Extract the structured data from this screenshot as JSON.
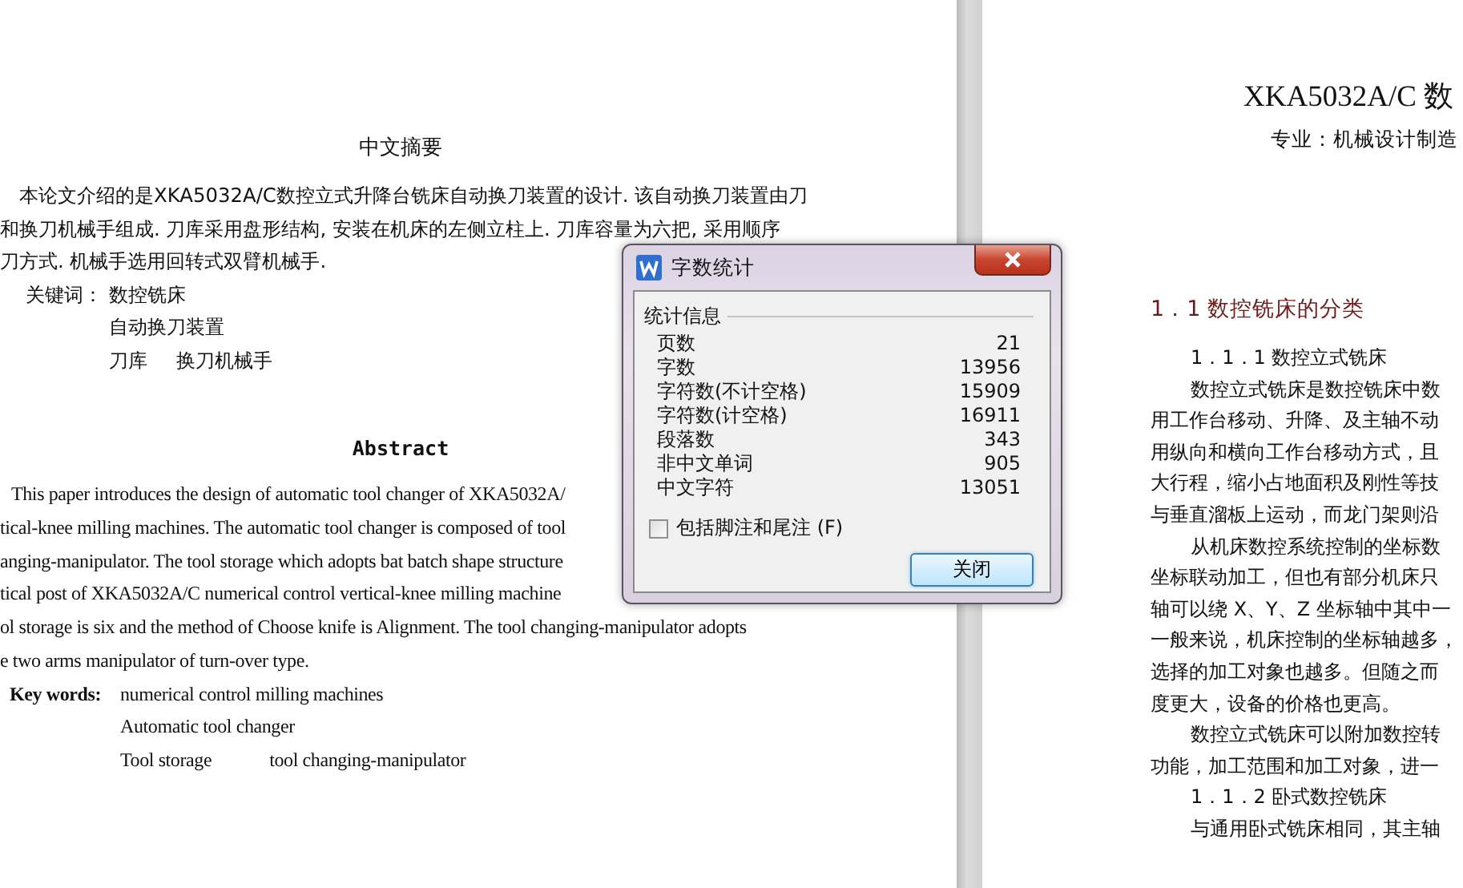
{
  "left_page": {
    "chinese_abstract": {
      "heading": "中文摘要",
      "paragraph_lines": [
        "本论文介绍的是XKA5032A/C数控立式升降台铣床自动换刀装置的设计. 该自动换刀装置由刀",
        "和换刀机械手组成. 刀库采用盘形结构, 安装在机床的左侧立柱上. 刀库容量为六把, 采用顺序",
        "刀方式. 机械手选用回转式双臂机械手."
      ],
      "keywords_label": "关键词：",
      "keyword_lines": [
        [
          "数控铣床"
        ],
        [
          "自动换刀装置"
        ],
        [
          "刀库",
          "换刀机械手"
        ]
      ]
    },
    "english_abstract": {
      "heading": "Abstract",
      "paragraph_lines": [
        "This paper introduces the design of automatic tool changer of XKA5032A/",
        "tical-knee milling machines. The automatic tool changer is composed of tool",
        "anging-manipulator. The tool storage which adopts bat batch shape structure",
        "tical post of XKA5032A/C numerical control vertical-knee milling machine",
        "ol storage is six and the method of Choose knife is Alignment. The tool changing-manipulator adopts",
        "e two arms manipulator of turn-over type."
      ],
      "keywords_label": "Key words:",
      "keyword_lines": [
        [
          "numerical control milling machines"
        ],
        [
          "Automatic tool changer"
        ],
        [
          "Tool storage",
          "tool changing-manipulator"
        ]
      ]
    }
  },
  "right_page": {
    "title": "XKA5032A/C 数",
    "major": "专业：机械设计制造",
    "lines": [
      {
        "kind": "section",
        "text": "1．1 数控铣床的分类"
      },
      {
        "kind": "subsection",
        "text": "1．1．1 数控立式铣床"
      },
      {
        "kind": "indent",
        "text": "数控立式铣床是数控铣床中数"
      },
      {
        "kind": "body",
        "text": "用工作台移动、升降、及主轴不动"
      },
      {
        "kind": "body",
        "text": "用纵向和横向工作台移动方式，且"
      },
      {
        "kind": "body",
        "text": "大行程，缩小占地面积及刚性等技"
      },
      {
        "kind": "body",
        "text": "与垂直溜板上运动，而龙门架则沿"
      },
      {
        "kind": "indent",
        "text": "从机床数控系统控制的坐标数"
      },
      {
        "kind": "body",
        "text": "坐标联动加工，但也有部分机床只"
      },
      {
        "kind": "body",
        "text": "轴可以绕 X、Y、Z 坐标轴中其中一"
      },
      {
        "kind": "body",
        "text": "一般来说，机床控制的坐标轴越多，"
      },
      {
        "kind": "body",
        "text": "选择的加工对象也越多。但随之而"
      },
      {
        "kind": "body",
        "text": "度更大，设备的价格也更高。"
      },
      {
        "kind": "indent",
        "text": "数控立式铣床可以附加数控转"
      },
      {
        "kind": "body",
        "text": "功能，加工范围和加工对象，进一"
      },
      {
        "kind": "subsection",
        "text": "1．1．2 卧式数控铣床"
      },
      {
        "kind": "indent",
        "text": "与通用卧式铣床相同，其主轴"
      }
    ]
  },
  "dialog": {
    "title": "字数统计",
    "group_label": "统计信息",
    "stats": [
      {
        "label": "页数",
        "value": "21"
      },
      {
        "label": "字数",
        "value": "13956"
      },
      {
        "label": "字符数(不计空格)",
        "value": "15909"
      },
      {
        "label": "字符数(计空格)",
        "value": "16911"
      },
      {
        "label": "段落数",
        "value": "343"
      },
      {
        "label": "非中文单词",
        "value": "905"
      },
      {
        "label": "中文字符",
        "value": "13051"
      }
    ],
    "include_footnotes": {
      "label": "包括脚注和尾注 (F)",
      "checked": false
    },
    "close_button": "关闭"
  }
}
